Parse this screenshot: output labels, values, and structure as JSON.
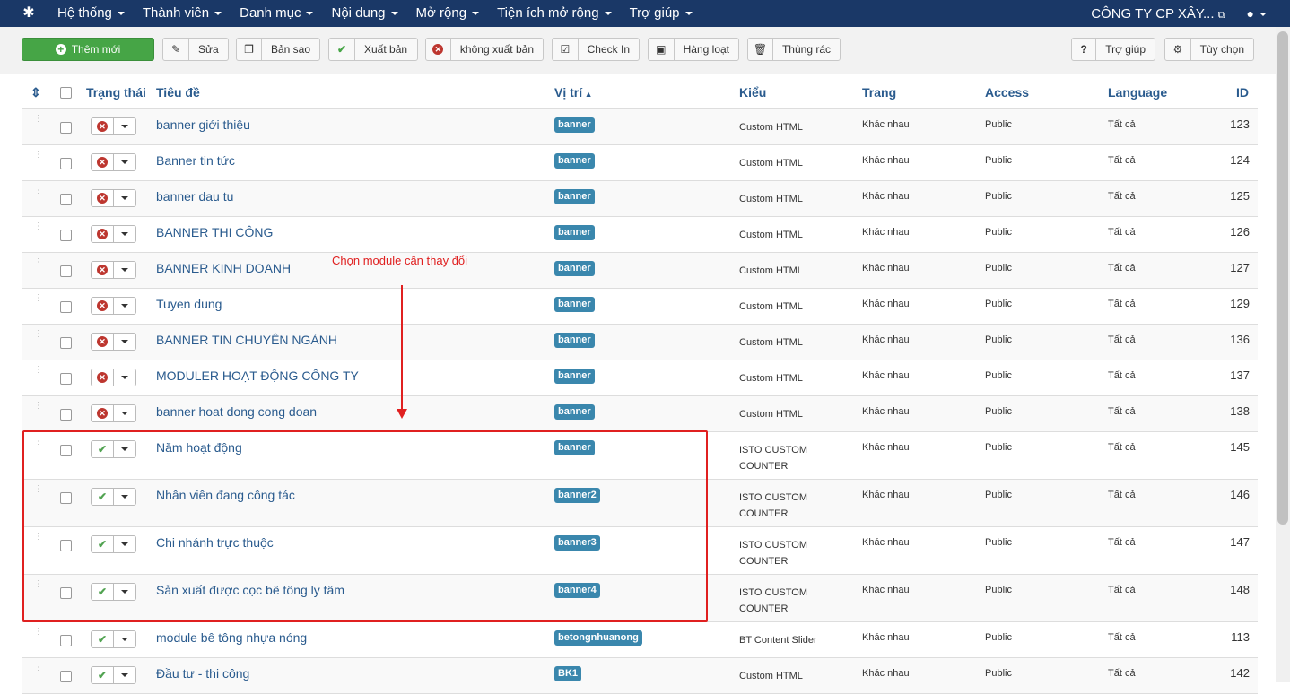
{
  "navbar": {
    "menu": [
      "Hệ thống",
      "Thành viên",
      "Danh mục",
      "Nội dung",
      "Mở rộng",
      "Tiện ích mở rộng",
      "Trợ giúp"
    ],
    "site": "CÔNG TY CP XÂY...",
    "user_icon": "user-icon"
  },
  "toolbar": {
    "new": "Thêm mới",
    "edit": "Sửa",
    "copy": "Bản sao",
    "publish": "Xuất bản",
    "unpublish": "không xuất bản",
    "checkin": "Check In",
    "batch": "Hàng loạt",
    "trash": "Thùng rác",
    "help": "Trợ giúp",
    "options": "Tùy chọn"
  },
  "table": {
    "headers": {
      "status": "Trạng thái",
      "title": "Tiêu đề",
      "position": "Vị trí",
      "type": "Kiểu",
      "pages": "Trang",
      "access": "Access",
      "language": "Language",
      "id": "ID"
    },
    "rows": [
      {
        "title": "banner giới thiệu",
        "position": "banner",
        "type": "Custom HTML",
        "pages": "Khác nhau",
        "access": "Public",
        "language": "Tất cả",
        "id": "123",
        "published": false
      },
      {
        "title": "Banner tin tức",
        "position": "banner",
        "type": "Custom HTML",
        "pages": "Khác nhau",
        "access": "Public",
        "language": "Tất cả",
        "id": "124",
        "published": false
      },
      {
        "title": "banner dau tu",
        "position": "banner",
        "type": "Custom HTML",
        "pages": "Khác nhau",
        "access": "Public",
        "language": "Tất cả",
        "id": "125",
        "published": false
      },
      {
        "title": "BANNER THI CÔNG",
        "position": "banner",
        "type": "Custom HTML",
        "pages": "Khác nhau",
        "access": "Public",
        "language": "Tất cả",
        "id": "126",
        "published": false
      },
      {
        "title": "BANNER KINH DOANH",
        "position": "banner",
        "type": "Custom HTML",
        "pages": "Khác nhau",
        "access": "Public",
        "language": "Tất cả",
        "id": "127",
        "published": false
      },
      {
        "title": "Tuyen dung",
        "position": "banner",
        "type": "Custom HTML",
        "pages": "Khác nhau",
        "access": "Public",
        "language": "Tất cả",
        "id": "129",
        "published": false
      },
      {
        "title": "BANNER TIN CHUYÊN NGÀNH",
        "position": "banner",
        "type": "Custom HTML",
        "pages": "Khác nhau",
        "access": "Public",
        "language": "Tất cả",
        "id": "136",
        "published": false
      },
      {
        "title": "MODULER HOẠT ĐỘNG CÔNG TY",
        "position": "banner",
        "type": "Custom HTML",
        "pages": "Khác nhau",
        "access": "Public",
        "language": "Tất cả",
        "id": "137",
        "published": false
      },
      {
        "title": "banner hoat dong cong doan",
        "position": "banner",
        "type": "Custom HTML",
        "pages": "Khác nhau",
        "access": "Public",
        "language": "Tất cả",
        "id": "138",
        "published": false
      },
      {
        "title": "Năm hoạt động",
        "position": "banner",
        "type": "ISTO CUSTOM COUNTER",
        "pages": "Khác nhau",
        "access": "Public",
        "language": "Tất cả",
        "id": "145",
        "published": true
      },
      {
        "title": "Nhân viên đang công tác",
        "position": "banner2",
        "type": "ISTO CUSTOM COUNTER",
        "pages": "Khác nhau",
        "access": "Public",
        "language": "Tất cả",
        "id": "146",
        "published": true
      },
      {
        "title": "Chi nhánh trực thuộc",
        "position": "banner3",
        "type": "ISTO CUSTOM COUNTER",
        "pages": "Khác nhau",
        "access": "Public",
        "language": "Tất cả",
        "id": "147",
        "published": true
      },
      {
        "title": "Sản xuất được cọc bê tông ly tâm",
        "position": "banner4",
        "type": "ISTO CUSTOM COUNTER",
        "pages": "Khác nhau",
        "access": "Public",
        "language": "Tất cả",
        "id": "148",
        "published": true
      },
      {
        "title": "module bê tông nhựa nóng",
        "position": "betongnhuanong",
        "type": "BT Content Slider",
        "pages": "Khác nhau",
        "access": "Public",
        "language": "Tất cả",
        "id": "113",
        "published": true
      },
      {
        "title": "Đầu tư - thi công",
        "position": "BK1",
        "type": "Custom HTML",
        "pages": "Khác nhau",
        "access": "Public",
        "language": "Tất cả",
        "id": "142",
        "published": true
      }
    ]
  },
  "annotation": {
    "note": "Chọn module cần thay đổi",
    "color": "#e02020"
  },
  "colors": {
    "navbar": "#1a3867",
    "new_button": "#46a546",
    "link": "#2a5b8e",
    "badge": "#3a87ad"
  }
}
